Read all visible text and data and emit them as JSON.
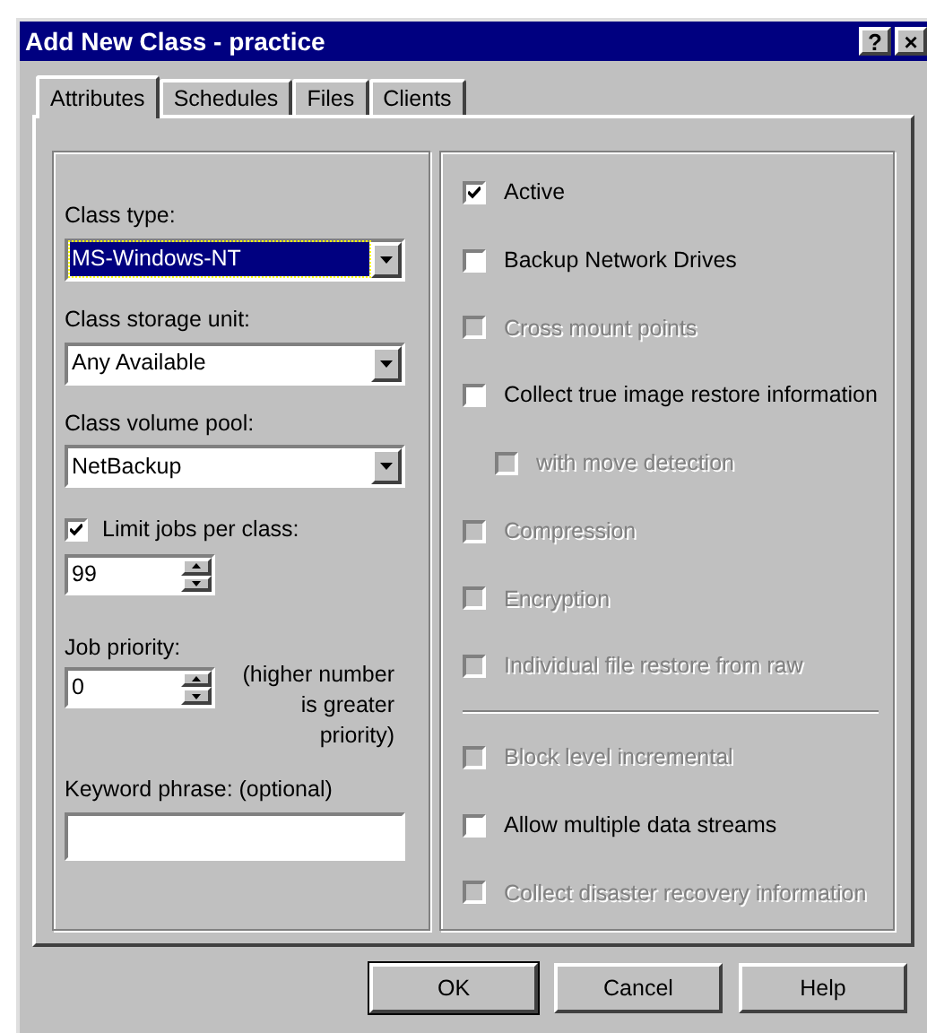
{
  "window": {
    "title": "Add New Class - practice",
    "title_buttons": [
      "?",
      "×"
    ]
  },
  "tabs": [
    {
      "label": "Attributes",
      "selected": true
    },
    {
      "label": "Schedules",
      "selected": false
    },
    {
      "label": "Files",
      "selected": false
    },
    {
      "label": "Clients",
      "selected": false
    }
  ],
  "class_type": {
    "label": "Class type:",
    "value": "MS-Windows-NT",
    "focused": true
  },
  "storage_unit": {
    "label": "Class storage unit:",
    "value": "Any Available",
    "focused": false
  },
  "volume_pool": {
    "label": "Class volume pool:",
    "value": "NetBackup",
    "focused": false
  },
  "limit_jobs": {
    "label": "Limit jobs per class:",
    "checked": true,
    "value": "99"
  },
  "job_priority": {
    "label": "Job priority:",
    "value": "0",
    "note": "(higher number is greater priority)"
  },
  "keyword": {
    "label": "Keyword phrase: (optional)"
  },
  "options": [
    {
      "kind": "checkbox",
      "label": "Active",
      "checked": true,
      "disabled": false
    },
    {
      "kind": "checkbox",
      "label": "Backup Network Drives",
      "checked": false,
      "disabled": false
    },
    {
      "kind": "checkbox",
      "label": "Cross mount points",
      "checked": false,
      "disabled": true
    },
    {
      "kind": "checkbox",
      "label": "Collect true image restore information",
      "checked": false,
      "disabled": false,
      "children": [
        {
          "kind": "checkbox",
          "label": "with move detection",
          "checked": false,
          "disabled": true
        }
      ]
    },
    {
      "kind": "checkbox",
      "label": "Compression",
      "checked": false,
      "disabled": true
    },
    {
      "kind": "checkbox",
      "label": "Encryption",
      "checked": false,
      "disabled": true
    },
    {
      "kind": "checkbox",
      "label": "Individual file restore from raw",
      "checked": false,
      "disabled": true
    },
    {
      "kind": "divider"
    },
    {
      "kind": "checkbox",
      "label": "Block level incremental",
      "checked": false,
      "disabled": true
    },
    {
      "kind": "checkbox",
      "label": "Allow multiple data streams",
      "checked": false,
      "disabled": false
    },
    {
      "kind": "checkbox",
      "label": "Collect disaster recovery information",
      "checked": false,
      "disabled": true
    }
  ],
  "buttons": [
    {
      "label": "OK",
      "default": true
    },
    {
      "label": "Cancel",
      "default": false
    },
    {
      "label": "Help",
      "default": false
    }
  ]
}
